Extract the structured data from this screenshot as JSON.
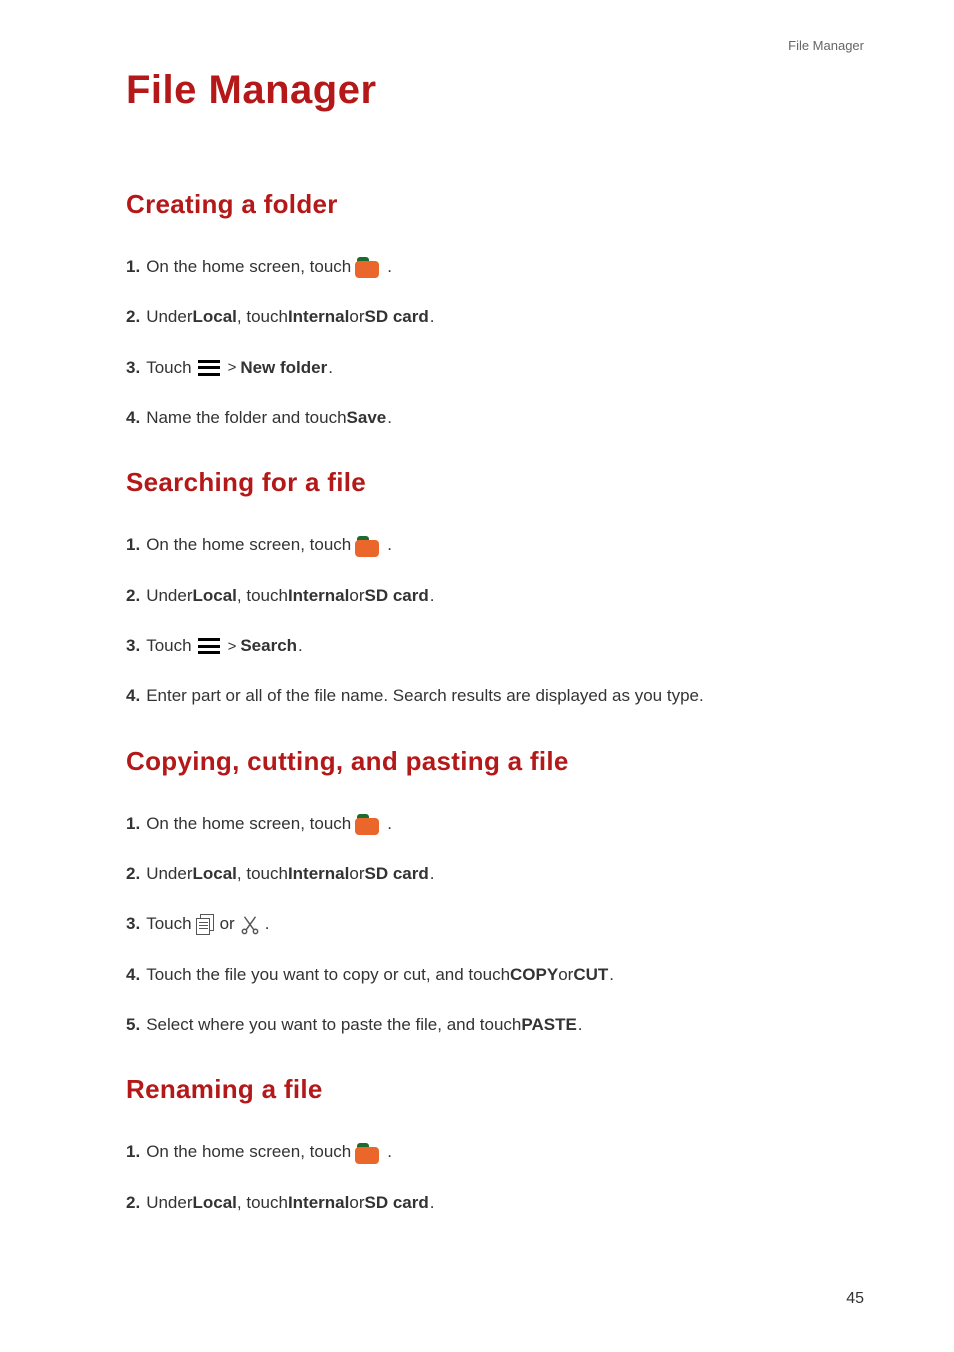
{
  "running_header": "File Manager",
  "page_title": "File Manager",
  "page_number": "45",
  "labels": {
    "local": "Local",
    "internal": "Internal",
    "sd_card": "SD card",
    "new_folder": "New folder",
    "save": "Save",
    "search": "Search",
    "copy": "COPY",
    "cut": "CUT",
    "paste": "PASTE"
  },
  "common": {
    "home_touch": "On the home screen, touch",
    "under": "Under ",
    "touch_word": ", touch ",
    "or_word": " or ",
    "touch_capital": "Touch",
    "gt": ">",
    "period": ".",
    "period_space": " ."
  },
  "sections": {
    "creating": {
      "heading": "Creating a folder",
      "step4": "Name the folder and touch "
    },
    "searching": {
      "heading": "Searching for a file",
      "step4": "Enter part or all of the file name. Search results are displayed as you type."
    },
    "copying": {
      "heading": "Copying, cutting, and pasting a file",
      "step4_a": "Touch the file you want to copy or cut, and touch ",
      "step5_a": "Select where you want to paste the file, and touch "
    },
    "renaming": {
      "heading": "Renaming a file"
    }
  }
}
